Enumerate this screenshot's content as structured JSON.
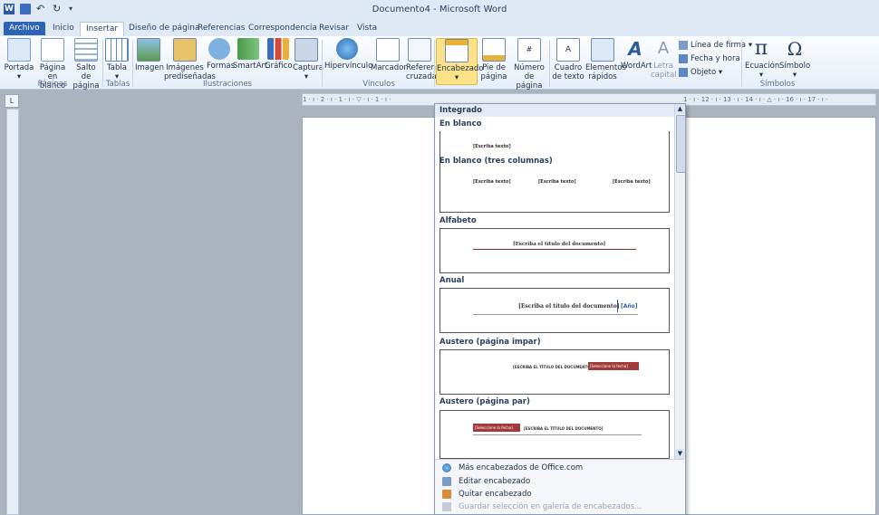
{
  "window": {
    "title": "Documento4 - Microsoft Word"
  },
  "tabs": [
    "Archivo",
    "Inicio",
    "Insertar",
    "Diseño de página",
    "Referencias",
    "Correspondencia",
    "Revisar",
    "Vista"
  ],
  "ribbon": {
    "buttons": {
      "portada": "Portada",
      "pagina_en_blanco_1": "Página",
      "pagina_en_blanco_2": "en blanco",
      "salto_de_pagina_1": "Salto de",
      "salto_de_pagina_2": "página",
      "tabla": "Tabla",
      "imagen": "Imagen",
      "imagenes_prediseñadas_1": "Imágenes",
      "imagenes_prediseñadas_2": "prediseñadas",
      "formas": "Formas",
      "smartart": "SmartArt",
      "grafico": "Gráfico",
      "captura": "Captura",
      "hipervinculo": "Hipervínculo",
      "marcador": "Marcador",
      "referencia_cruzada_1": "Referencia",
      "referencia_cruzada_2": "cruzada",
      "encabezado": "Encabezado",
      "pie_de_pagina_1": "Pie de",
      "pie_de_pagina_2": "página",
      "numero_de_pagina_1": "Número de",
      "numero_de_pagina_2": "página",
      "cuadro_de_texto_1": "Cuadro",
      "cuadro_de_texto_2": "de texto",
      "elementos_rapidos_1": "Elementos",
      "elementos_rapidos_2": "rápidos",
      "wordart": "WordArt",
      "letra_capital_1": "Letra",
      "letra_capital_2": "capital",
      "linea_de_firma": "Línea de firma",
      "fecha_y_hora": "Fecha y hora",
      "objeto": "Objeto",
      "ecuacion": "Ecuación",
      "simbolo": "Símbolo"
    },
    "groups": {
      "paginas": "Páginas",
      "tablas": "Tablas",
      "ilustraciones": "Ilustraciones",
      "vinculos": "Vínculos",
      "simbolos": "Símbolos"
    }
  },
  "ruler": {
    "ticks": "1 · ı · 2 · ı · 1 · ı · ▽ · ı · 1 · ı ·",
    "ticks_right": "1 · ı · 12 · ı · 13 · ı · 14 · ı · △ · ı · 16 · ı · 17 · ı ·"
  },
  "gallery": {
    "header": "Integrado",
    "items": [
      {
        "title": "En blanco",
        "placeholder": "[Escriba texto]"
      },
      {
        "title": "En blanco (tres columnas)",
        "placeholder": "[Escriba texto]"
      },
      {
        "title": "Alfabeto",
        "placeholder": "[Escriba el título del documento]"
      },
      {
        "title": "Anual",
        "placeholder": "[Escriba el título del documento]",
        "extra": "[Año]"
      },
      {
        "title": "Austero (página impar)",
        "placeholder": "[ESCRIBA EL TÍTULO DEL DOCUMENTO]",
        "extra": "[Seleccione la fecha]"
      },
      {
        "title": "Austero (página par)",
        "placeholder": "[ESCRIBA EL TÍTULO DEL DOCUMENTO]",
        "extra": "[Seleccione la fecha]"
      }
    ],
    "menu": {
      "mas": "Más encabezados de Office.com",
      "editar": "Editar encabezado",
      "quitar": "Quitar encabezado",
      "guardar": "Guardar selección en galería de encabezados..."
    }
  },
  "colors": {
    "accent_file": "#2c64b8",
    "selected": "#fce38a",
    "alfabeto_line": "#8b2a2a",
    "austero_red": "#a33a3a",
    "anual_blue": "#2c5aa0"
  }
}
